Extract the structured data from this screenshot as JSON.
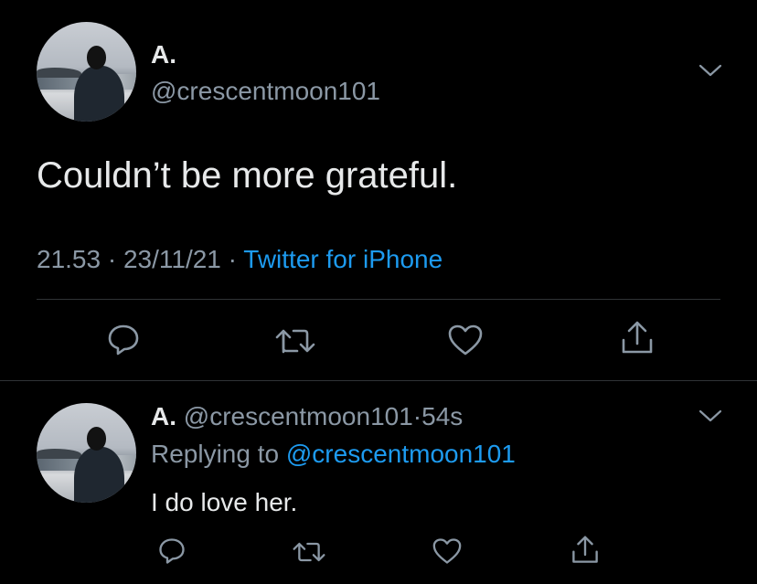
{
  "main_tweet": {
    "display_name": "A.",
    "handle": "@crescentmoon101",
    "text": "Couldn’t be more grateful.",
    "time": "21.53",
    "date": "23/11/21",
    "separator": "·",
    "source": "Twitter for iPhone"
  },
  "reply": {
    "display_name": "A.",
    "handle": "@crescentmoon101",
    "separator": "·",
    "age": "54s",
    "replying_prefix": "Replying to",
    "replying_handle": "@crescentmoon101",
    "text": "I do love her."
  },
  "icons": {
    "reply": "speech-bubble-icon",
    "retweet": "retweet-icon",
    "like": "heart-icon",
    "share": "share-icon",
    "more": "chevron-down-icon"
  },
  "colors": {
    "background": "#000000",
    "text": "#e7e9ea",
    "secondary": "#8b98a5",
    "link": "#1d9bf0",
    "divider": "#2f3336"
  }
}
